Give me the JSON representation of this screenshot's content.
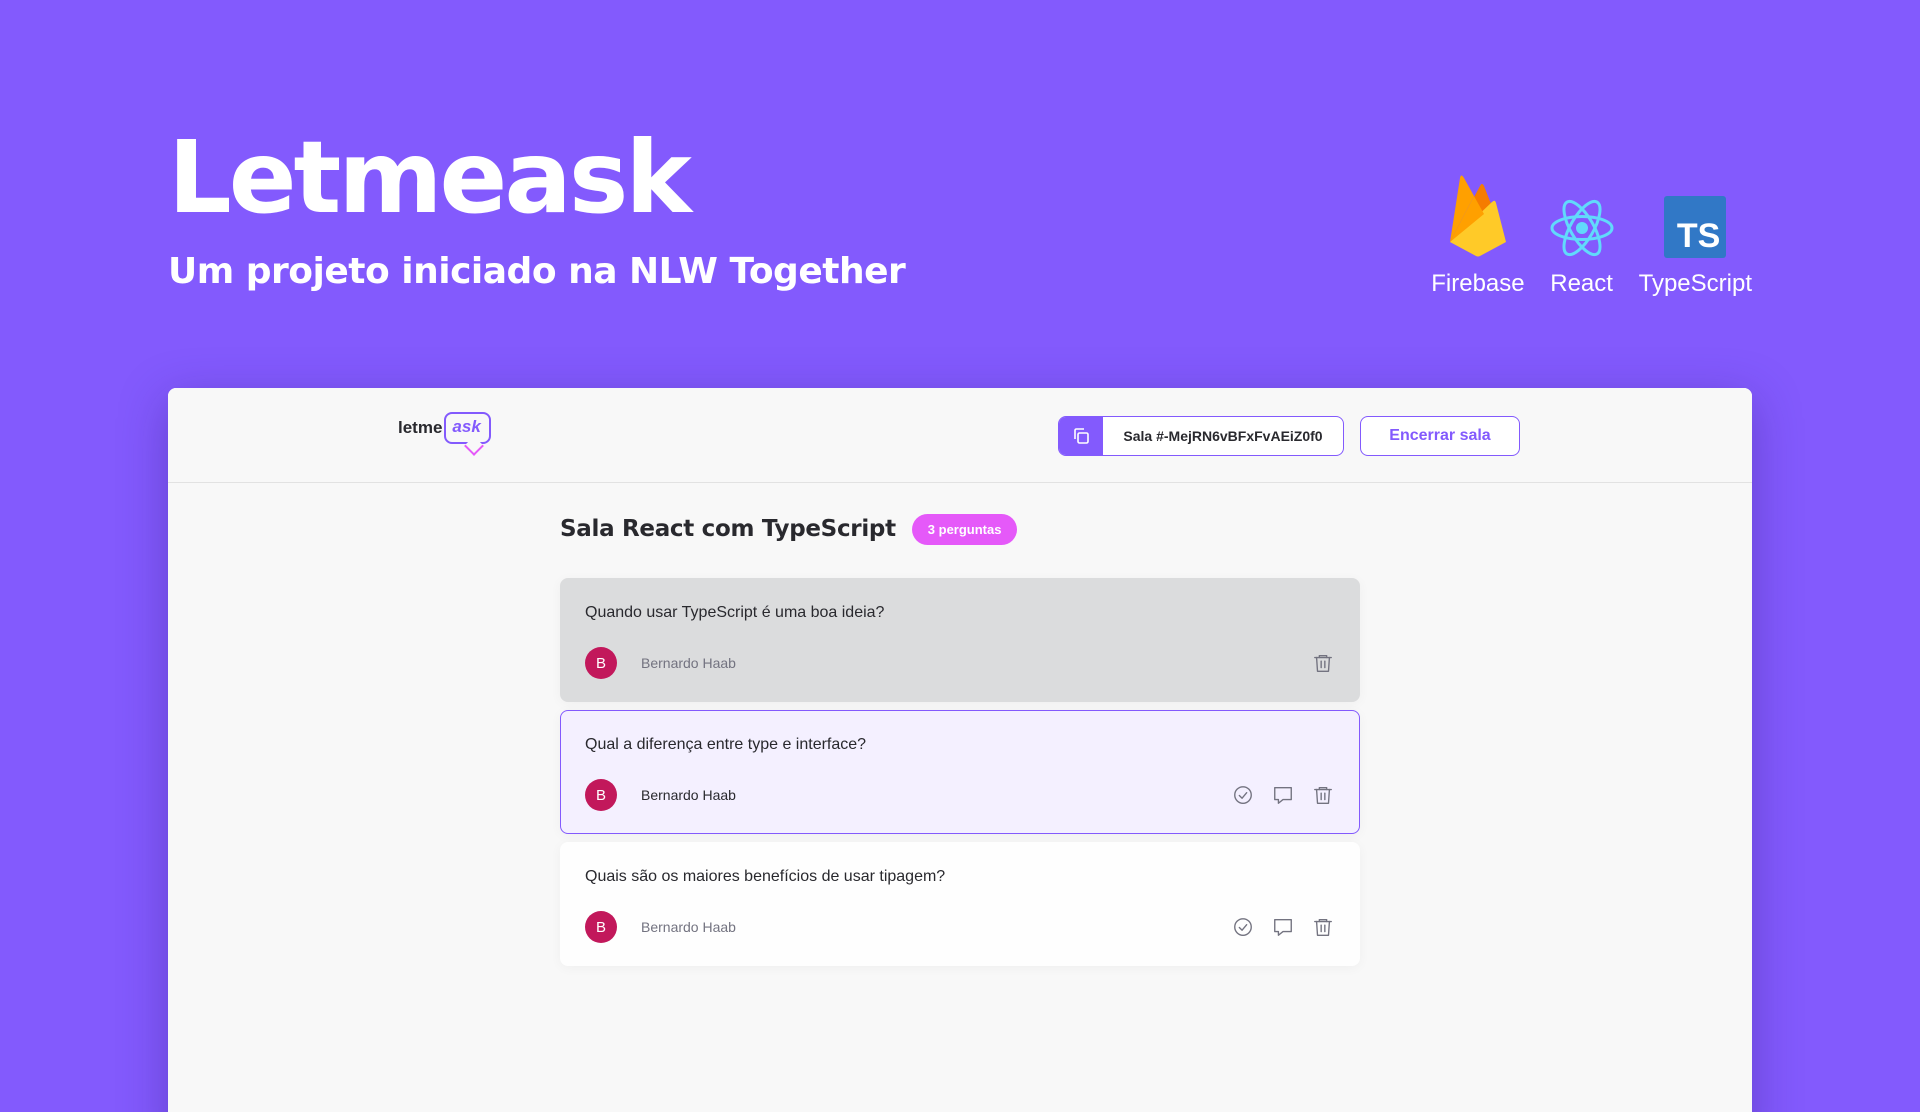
{
  "hero": {
    "title": "Letmeask",
    "subtitle": "Um projeto iniciado na NLW Together"
  },
  "techs": [
    {
      "label": "Firebase",
      "icon": "firebase-icon",
      "color": "#ffca28"
    },
    {
      "label": "React",
      "icon": "react-icon",
      "color": "#61dafb"
    },
    {
      "label": "TypeScript",
      "icon": "typescript-icon",
      "color": "#3178c6",
      "badge": "TS"
    }
  ],
  "app": {
    "logo": {
      "prefix": "letme",
      "suffix": "ask"
    },
    "room_code_label": "Sala #-MejRN6vBFxFvAEiZ0f0",
    "end_room_label": "Encerrar sala",
    "room_title": "Sala React com TypeScript",
    "question_count": "3 perguntas",
    "questions": [
      {
        "text": "Quando usar TypeScript é uma boa ideia?",
        "author": "Bernardo Haab",
        "avatar": "B",
        "state": "answered"
      },
      {
        "text": "Qual a diferença entre type e interface?",
        "author": "Bernardo Haab",
        "avatar": "B",
        "state": "highlighted"
      },
      {
        "text": "Quais são os maiores benefícios de usar tipagem?",
        "author": "Bernardo Haab",
        "avatar": "B",
        "state": "normal"
      }
    ]
  },
  "colors": {
    "background": "#835afd",
    "accent": "#835afd",
    "badge": "#e559f9",
    "avatar": "#c2185b"
  }
}
